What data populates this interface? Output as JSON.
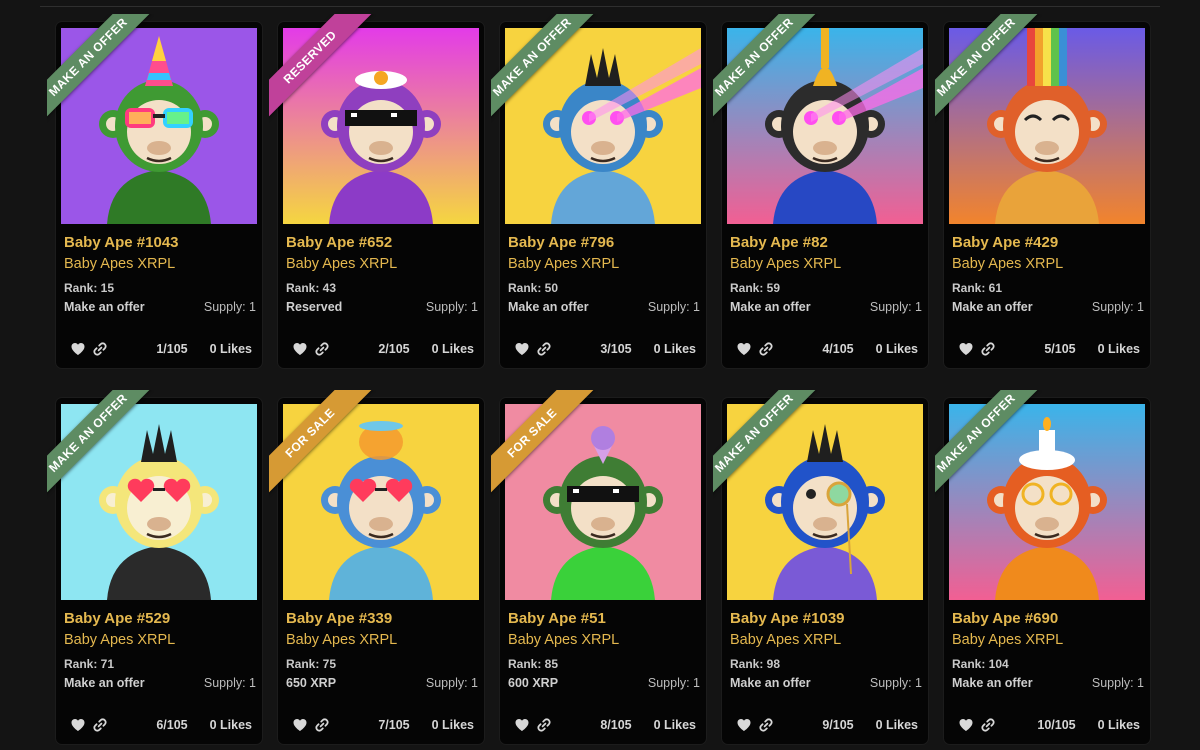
{
  "colors": {
    "accent_gold": "#e4b84f",
    "ribbon_offer": "#5e8c63",
    "ribbon_reserved": "#c0419a",
    "ribbon_sale": "#d69a34"
  },
  "cards": [
    {
      "ribbon": "MAKE AN OFFER",
      "ribbon_type": "offer",
      "title": "Baby Ape #1043",
      "collection": "Baby Apes XRPL",
      "rank": "Rank: 15",
      "status": "Make an offer",
      "supply": "Supply: 1",
      "edition": "1/105",
      "likes": "0 Likes",
      "bg": [
        "#9b56e8",
        "#9b56e8"
      ],
      "fur": "#3f9a33",
      "face": "#f3e0c7",
      "outfit": "#2f7a26",
      "hat": "party",
      "eyes": "rainbow-glasses",
      "icon": "ape-avatar"
    },
    {
      "ribbon": "RESERVED",
      "ribbon_type": "reserved",
      "title": "Baby Ape #652",
      "collection": "Baby Apes XRPL",
      "rank": "Rank: 43",
      "status": "Reserved",
      "supply": "Supply: 1",
      "edition": "2/105",
      "likes": "0 Likes",
      "bg": [
        "#e33be8",
        "#f5d640"
      ],
      "fur": "#8f3fbf",
      "face": "#f3e0c7",
      "outfit": "#8c3bc7",
      "hat": "egg",
      "eyes": "pixel-shades",
      "icon": "ape-avatar"
    },
    {
      "ribbon": "MAKE AN OFFER",
      "ribbon_type": "offer",
      "title": "Baby Ape #796",
      "collection": "Baby Apes XRPL",
      "rank": "Rank: 50",
      "status": "Make an offer",
      "supply": "Supply: 1",
      "edition": "3/105",
      "likes": "0 Likes",
      "bg": [
        "#f7d33f",
        "#f7d33f"
      ],
      "fur": "#3a86c8",
      "face": "#f3e0c7",
      "outfit": "#63a6d8",
      "hat": "mohawk",
      "eyes": "laser",
      "icon": "ape-avatar"
    },
    {
      "ribbon": "MAKE AN OFFER",
      "ribbon_type": "offer",
      "title": "Baby Ape #82",
      "collection": "Baby Apes XRPL",
      "rank": "Rank: 59",
      "status": "Make an offer",
      "supply": "Supply: 1",
      "edition": "4/105",
      "likes": "0 Likes",
      "bg": [
        "#3ab4ea",
        "#f25f93"
      ],
      "fur": "#2c2c2c",
      "face": "#f3e0c7",
      "outfit": "#2748c4",
      "hat": "drip",
      "eyes": "laser",
      "icon": "ape-avatar"
    },
    {
      "ribbon": "MAKE AN OFFER",
      "ribbon_type": "offer",
      "title": "Baby Ape #429",
      "collection": "Baby Apes XRPL",
      "rank": "Rank: 61",
      "status": "Make an offer",
      "supply": "Supply: 1",
      "edition": "5/105",
      "likes": "0 Likes",
      "bg": [
        "#6a5ae6",
        "#f2842c"
      ],
      "fur": "#e0602a",
      "face": "#f3e0c7",
      "outfit": "#e9a33a",
      "hat": "rainbow-drip",
      "eyes": "happy",
      "icon": "ape-avatar"
    },
    {
      "ribbon": "MAKE AN OFFER",
      "ribbon_type": "offer",
      "title": "Baby Ape #529",
      "collection": "Baby Apes XRPL",
      "rank": "Rank: 71",
      "status": "Make an offer",
      "supply": "Supply: 1",
      "edition": "6/105",
      "likes": "0 Likes",
      "bg": [
        "#8ee6f2",
        "#8ee6f2"
      ],
      "fur": "#f4e67a",
      "face": "#f8efd2",
      "outfit": "#2a2a2a",
      "hat": "mohawk",
      "eyes": "heart-glasses",
      "icon": "ape-avatar"
    },
    {
      "ribbon": "FOR SALE",
      "ribbon_type": "sale",
      "title": "Baby Ape #339",
      "collection": "Baby Apes XRPL",
      "rank": "Rank: 75",
      "status": "650 XRP",
      "supply": "Supply: 1",
      "edition": "7/105",
      "likes": "0 Likes",
      "bg": [
        "#f7d33f",
        "#f7d33f"
      ],
      "fur": "#4a8fd6",
      "face": "#f3e0c7",
      "outfit": "#5fb3d9",
      "hat": "fishbowl",
      "eyes": "heart-glasses",
      "icon": "ape-avatar"
    },
    {
      "ribbon": "FOR SALE",
      "ribbon_type": "sale",
      "title": "Baby Ape #51",
      "collection": "Baby Apes XRPL",
      "rank": "Rank: 85",
      "status": "600 XRP",
      "supply": "Supply: 1",
      "edition": "8/105",
      "likes": "0 Likes",
      "bg": [
        "#f08ba2",
        "#f08ba2"
      ],
      "fur": "#3f7d34",
      "face": "#f3e0c7",
      "outfit": "#3ad13a",
      "hat": "icecream",
      "eyes": "pixel-shades",
      "icon": "ape-avatar"
    },
    {
      "ribbon": "MAKE AN OFFER",
      "ribbon_type": "offer",
      "title": "Baby Ape #1039",
      "collection": "Baby Apes XRPL",
      "rank": "Rank: 98",
      "status": "Make an offer",
      "supply": "Supply: 1",
      "edition": "9/105",
      "likes": "0 Likes",
      "bg": [
        "#f7d33f",
        "#f7d33f"
      ],
      "fur": "#2153c9",
      "face": "#f3e0c7",
      "outfit": "#7a5ad6",
      "hat": "mohawk",
      "eyes": "monocle",
      "icon": "ape-avatar"
    },
    {
      "ribbon": "MAKE AN OFFER",
      "ribbon_type": "offer",
      "title": "Baby Ape #690",
      "collection": "Baby Apes XRPL",
      "rank": "Rank: 104",
      "status": "Make an offer",
      "supply": "Supply: 1",
      "edition": "10/105",
      "likes": "0 Likes",
      "bg": [
        "#3ab4ea",
        "#f25f93"
      ],
      "fur": "#e55e22",
      "face": "#f3e0c7",
      "outfit": "#f08a1c",
      "hat": "candle",
      "eyes": "round-glasses",
      "icon": "ape-avatar"
    }
  ]
}
